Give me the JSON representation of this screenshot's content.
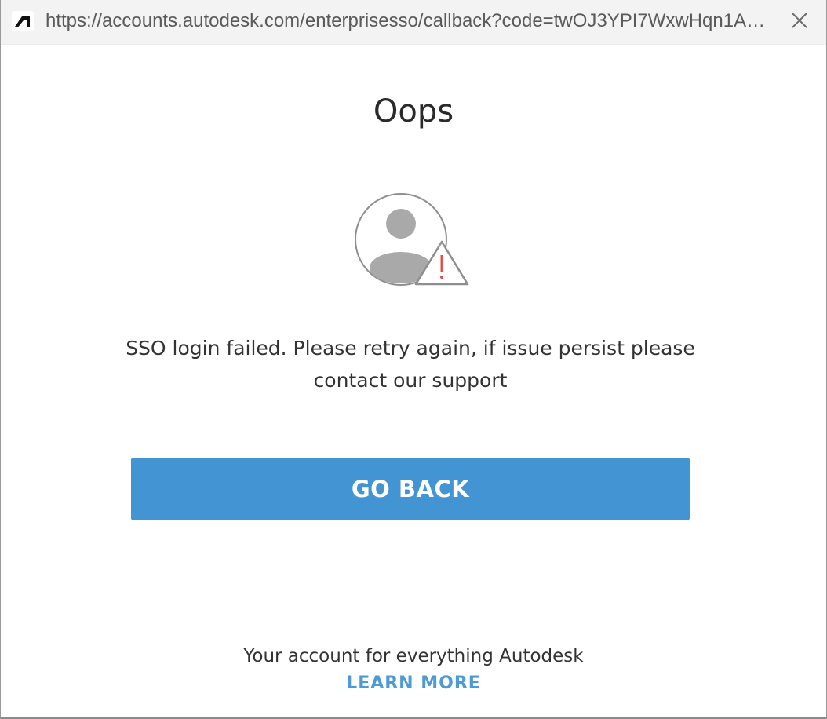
{
  "window": {
    "url": "https://accounts.autodesk.com/enterprisesso/callback?code=twOJ3YPI7WxwHqn1AAT...",
    "app_icon": "autodesk-logo-icon",
    "close_icon": "close-icon"
  },
  "main": {
    "title": "Oops",
    "illustration_icon": "user-warning-icon",
    "message": "SSO login failed. Please retry again, if issue persist please contact our support",
    "go_back_label": "GO BACK"
  },
  "footer": {
    "tagline": "Your account for everything Autodesk",
    "learn_more_label": "LEARN MORE"
  },
  "colors": {
    "button": "#4394d2",
    "link": "#4d9ad6",
    "warning": "#e2504c",
    "titlebar": "#f3f3f3"
  }
}
